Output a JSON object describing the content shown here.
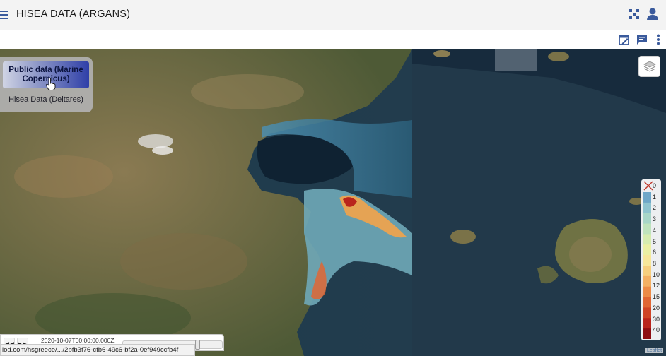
{
  "app": {
    "title": "HISEA DATA (ARGANS)"
  },
  "icons": {
    "menu": "hamburger-menu-icon",
    "apps": "apps-grid-icon",
    "user": "user-account-icon",
    "edit": "edit-calendar-icon",
    "comment": "comment-icon",
    "more": "more-vertical-icon",
    "layers": "layers-icon",
    "close": "close-icon"
  },
  "colors": {
    "accent": "#3a5a9c",
    "active_layer": "#2f3fa8"
  },
  "layer_menu": {
    "items": [
      {
        "label": "Public data (Marine Copernicus)",
        "active": true
      },
      {
        "label": "Hisea Data (Deltares)",
        "active": false
      }
    ]
  },
  "legend": {
    "labels": [
      "0",
      "1",
      "2",
      "3",
      "4",
      "5",
      "6",
      "8",
      "10",
      "12",
      "15",
      "20",
      "30",
      "40"
    ],
    "colors": [
      "#6ea7c8",
      "#8fc4cf",
      "#a8d6c8",
      "#bfe3bd",
      "#d6ecb0",
      "#ebf0a4",
      "#f7e79a",
      "#f6cf7e",
      "#f3b063",
      "#ec8b47",
      "#e06634",
      "#cf4426",
      "#b9241c",
      "#8e0d12"
    ]
  },
  "time_control": {
    "back_label": "◀◀",
    "forward_label": "▶▶",
    "timestamp": "2020-10-07T00:00:00.000Z",
    "position": 0.77
  },
  "status_bar": {
    "url": "iod.com/hsgreece/.../2bfb3f76-cfb6-49c6-bf2a-0ef949ccfb4f"
  },
  "attribution": "Leaflet"
}
